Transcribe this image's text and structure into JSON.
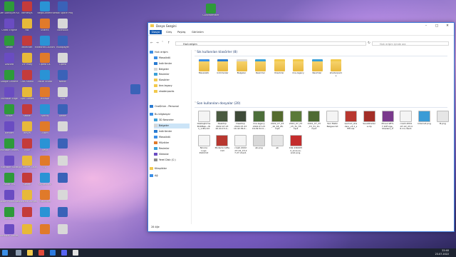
{
  "window": {
    "title": "Dosya Gezgini",
    "ribbon_tabs": [
      "Dosya",
      "Giriş",
      "Paylaş",
      "Görünüm"
    ],
    "address": "Hızlı erişim",
    "search_placeholder": "Hızlı erişim içinde ara",
    "status": "28 öğe",
    "accent_color": "#1a5fb4"
  },
  "nav": {
    "quick_access": "Hızlı erişim",
    "items": [
      "Masaüstü",
      "İndirilenler",
      "Belgeler",
      "Resimler",
      "Klasörler",
      "öne-legacy",
      "shaderpacks"
    ],
    "onedrive": "OneDrive - Personal",
    "this_pc": "Bu bilgisayar",
    "pc_items": [
      "3D Nesneler",
      "Belgeler",
      "İndirilenler",
      "Masaüstü",
      "Müzikler",
      "Resimler",
      "Videolar",
      "Yerel Disk (C:)"
    ],
    "libraries": "Kitaplıklar",
    "network": "Ağ"
  },
  "frequent": {
    "header": "Sık kullanılan klasörler (8)",
    "items": [
      "Masaüstü",
      "İndirilenler",
      "Belgeler",
      "Resimler",
      "Klasörler",
      "öne-legacy",
      "Resimler",
      "shaderpack\ns"
    ]
  },
  "recent": {
    "header": "Son kullanılan dosyalar (20)",
    "items": [
      "Özelleştirme\nBirDBap—W\n1_1.8ts.txt",
      "Desktop\n2022.07.23\n16.44.15.0...",
      "Desktop\n2022.07.23\n16.42.36.0...",
      "öne-legacy\n2022.07.23\n16.09.52.0...",
      "2022_07_23\n_16_18_26.\nmp4",
      "2022_07_23\n_15_31_35.\nmp4",
      "2022_07_23\n_15_31_21.\nmp4",
      "Yeni Metin\nBelgesi.txt",
      "wemod_sha\nders_v3.1_s\nfiltr.zip",
      "SeusShader\ns.zip",
      "Minecraft%\n7.10Forge_\nShaders_O\nptifine0.0...",
      "crash-2022\n-07-22_23.4\n6.11-client.\ntxt",
      "İnternet.png",
      "B.png",
      "Növice\nLogo\n4924.txt",
      "Modsmicrafte\nr.txt",
      "crash-2022\n-07-22_15.2\n7.27-client.\ntxt",
      "ab.png",
      "ab",
      "162-160205\n2_snvs-vs-\nandr-png.\npng"
    ]
  },
  "desktop_icons": [
    "Geri Dönüşüm Kutusu",
    "Kernelsys",
    "NegoContent",
    "Kerbal Space Program",
    "Cheat Engine",
    "Rol",
    "ShareX",
    "NoteBook",
    "Steam",
    "Minecraft",
    "Minecraft Launcher",
    "Multiplayer",
    "Discord",
    "VIP Proxy",
    "Opera GX",
    "Opera",
    "Google Chrome",
    "OBS Studio",
    "Visual Studio",
    "Notion",
    "Microsoft Edge",
    "Epic Games",
    "WinRAR",
    "Epic",
    "Brave",
    "Sablon",
    "Spotify",
    "Adobe",
    "Blender",
    "dosya",
    "Zoom",
    "",
    "Microsoft Teams",
    "Oyun",
    "Keşif",
    "",
    "Microsoft Store",
    "Epic Games Launcher",
    "EA",
    "",
    "Radar Pro",
    "Steam",
    "Kaydedicisi",
    "",
    "Adobe Photoshop",
    "Minecraft Dungeons",
    "TLauncher",
    "",
    "Rockstar",
    "",
    "",
    "",
    "Rockstar Games",
    "",
    "",
    ""
  ],
  "desktop_top_icon": "Güncellemeler",
  "clock": {
    "time": "22:40",
    "date": "23.07.2022"
  }
}
